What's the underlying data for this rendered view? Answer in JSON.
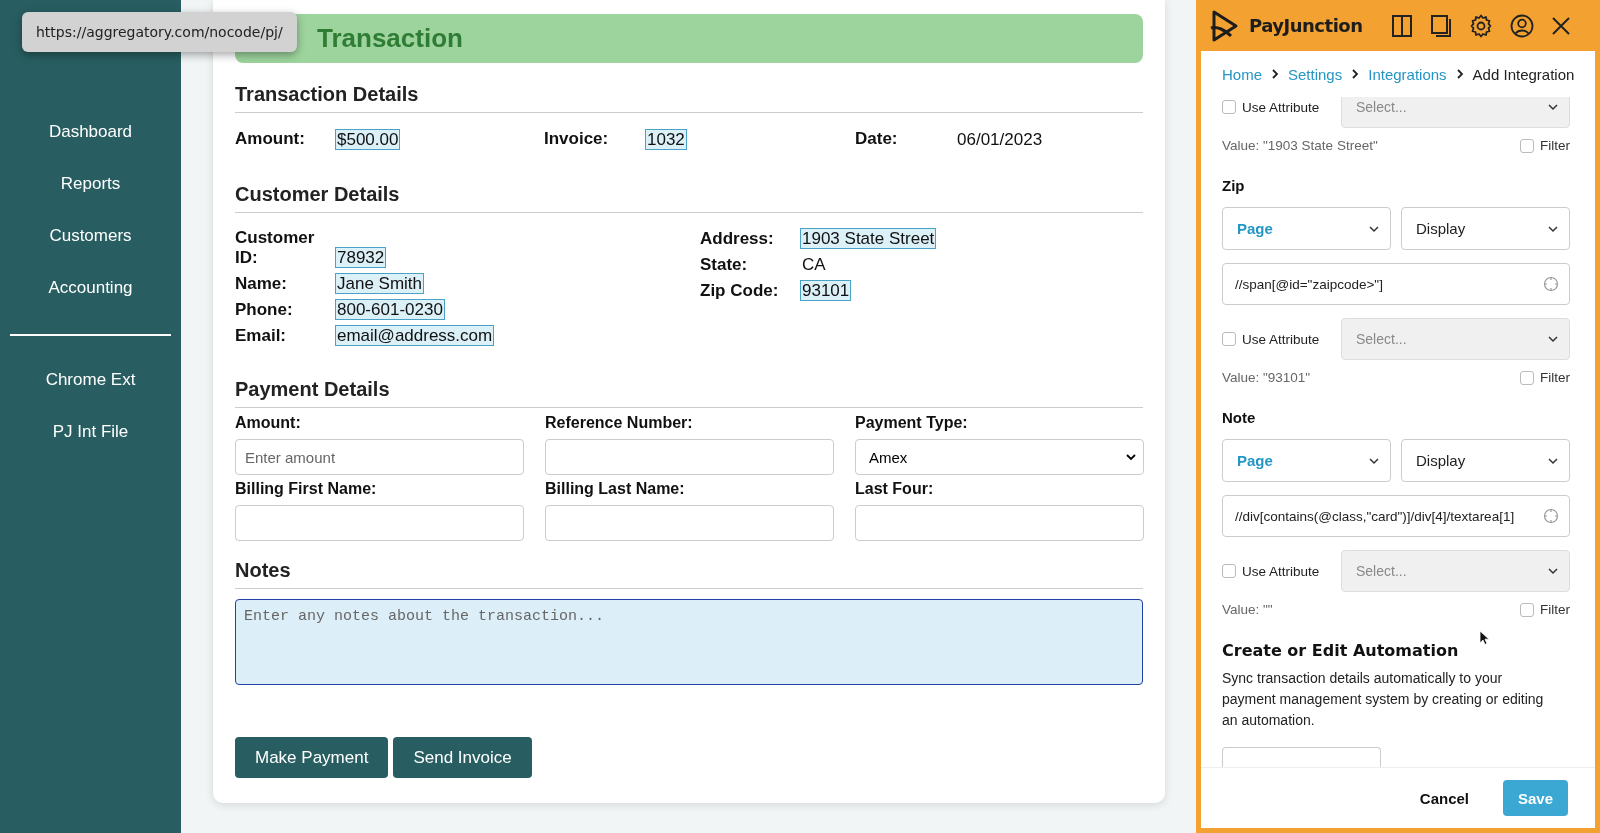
{
  "tooltip": {
    "url": "https://aggregatory.com/nocode/pj/"
  },
  "sidebar": {
    "groups": [
      [
        {
          "label": "Dashboard"
        },
        {
          "label": "Reports"
        },
        {
          "label": "Customers"
        },
        {
          "label": "Accounting"
        }
      ],
      [
        {
          "label": "Chrome Ext"
        },
        {
          "label": "PJ Int File"
        }
      ]
    ]
  },
  "form": {
    "title": "Transaction",
    "transaction_details": {
      "heading": "Transaction Details",
      "fields": [
        {
          "label": "Amount:",
          "value": "$500.00",
          "highlighted": true
        },
        {
          "label": "Invoice:",
          "value": "1032",
          "highlighted": true
        },
        {
          "label": "Date:",
          "value": "06/01/2023",
          "highlighted": false
        }
      ]
    },
    "customer_details": {
      "heading": "Customer Details",
      "columns": [
        [
          {
            "label": "Customer ID:",
            "value": "78932",
            "highlighted": true
          },
          {
            "label": "Name:",
            "value": "Jane Smith",
            "highlighted": true
          },
          {
            "label": "Phone:",
            "value": "800-601-0230",
            "highlighted": true
          },
          {
            "label": "Email:",
            "value": "email@address.com",
            "highlighted": true
          }
        ],
        [
          {
            "label": "Address:",
            "value": "1903 State Street",
            "highlighted": true
          },
          {
            "label": "State:",
            "value": "CA",
            "highlighted": false
          },
          {
            "label": "Zip Code:",
            "value": "93101",
            "highlighted": true
          }
        ]
      ]
    },
    "payment_details": {
      "heading": "Payment Details",
      "fields": [
        {
          "label": "Amount:",
          "kind": "input",
          "placeholder": "Enter amount"
        },
        {
          "label": "Reference Number:",
          "kind": "input"
        },
        {
          "label": "Payment Type:",
          "kind": "select",
          "value": "Amex"
        },
        {
          "label": "Billing First Name:",
          "kind": "input"
        },
        {
          "label": "Billing Last Name:",
          "kind": "input"
        },
        {
          "label": "Last Four:",
          "kind": "input"
        }
      ]
    },
    "notes": {
      "heading": "Notes",
      "placeholder": "Enter any notes about the transaction...",
      "focused": true
    },
    "buttons": [
      "Make Payment",
      "Send Invoice"
    ]
  },
  "panel": {
    "brand": "PayJunction",
    "breadcrumb": [
      {
        "label": "Home",
        "link": true
      },
      {
        "label": "Settings",
        "link": true
      },
      {
        "label": "Integrations",
        "link": true
      },
      {
        "label": "Add Integration",
        "link": false
      }
    ],
    "partial_mapping": {
      "use_attribute": {
        "label": "Use Attribute",
        "checked": false
      },
      "attribute_select": "Select...",
      "value": "Value: \"1903 State Street\"",
      "filter": {
        "label": "Filter",
        "checked": false
      }
    },
    "mappings": [
      {
        "title": "Zip",
        "source": "Page",
        "mode": "Display",
        "xpath": "//span[@id=\"zaipcode>\"]",
        "use_attribute": {
          "label": "Use Attribute",
          "checked": false
        },
        "attribute_select": "Select...",
        "value": "Value: \"93101\"",
        "filter": {
          "label": "Filter",
          "checked": false
        }
      },
      {
        "title": "Note",
        "source": "Page",
        "mode": "Display",
        "xpath": "//div[contains(@class,\"card\")]/div[4]/textarea[1]",
        "use_attribute": {
          "label": "Use Attribute",
          "checked": false
        },
        "attribute_select": "Select...",
        "value": "Value: \"\"",
        "filter": {
          "label": "Filter",
          "checked": false
        }
      }
    ],
    "automation": {
      "heading": "Create or Edit Automation",
      "text": "Sync transaction details automatically to your payment management system by creating or editing an automation."
    },
    "footer": {
      "cancel": "Cancel",
      "save": "Save"
    }
  }
}
